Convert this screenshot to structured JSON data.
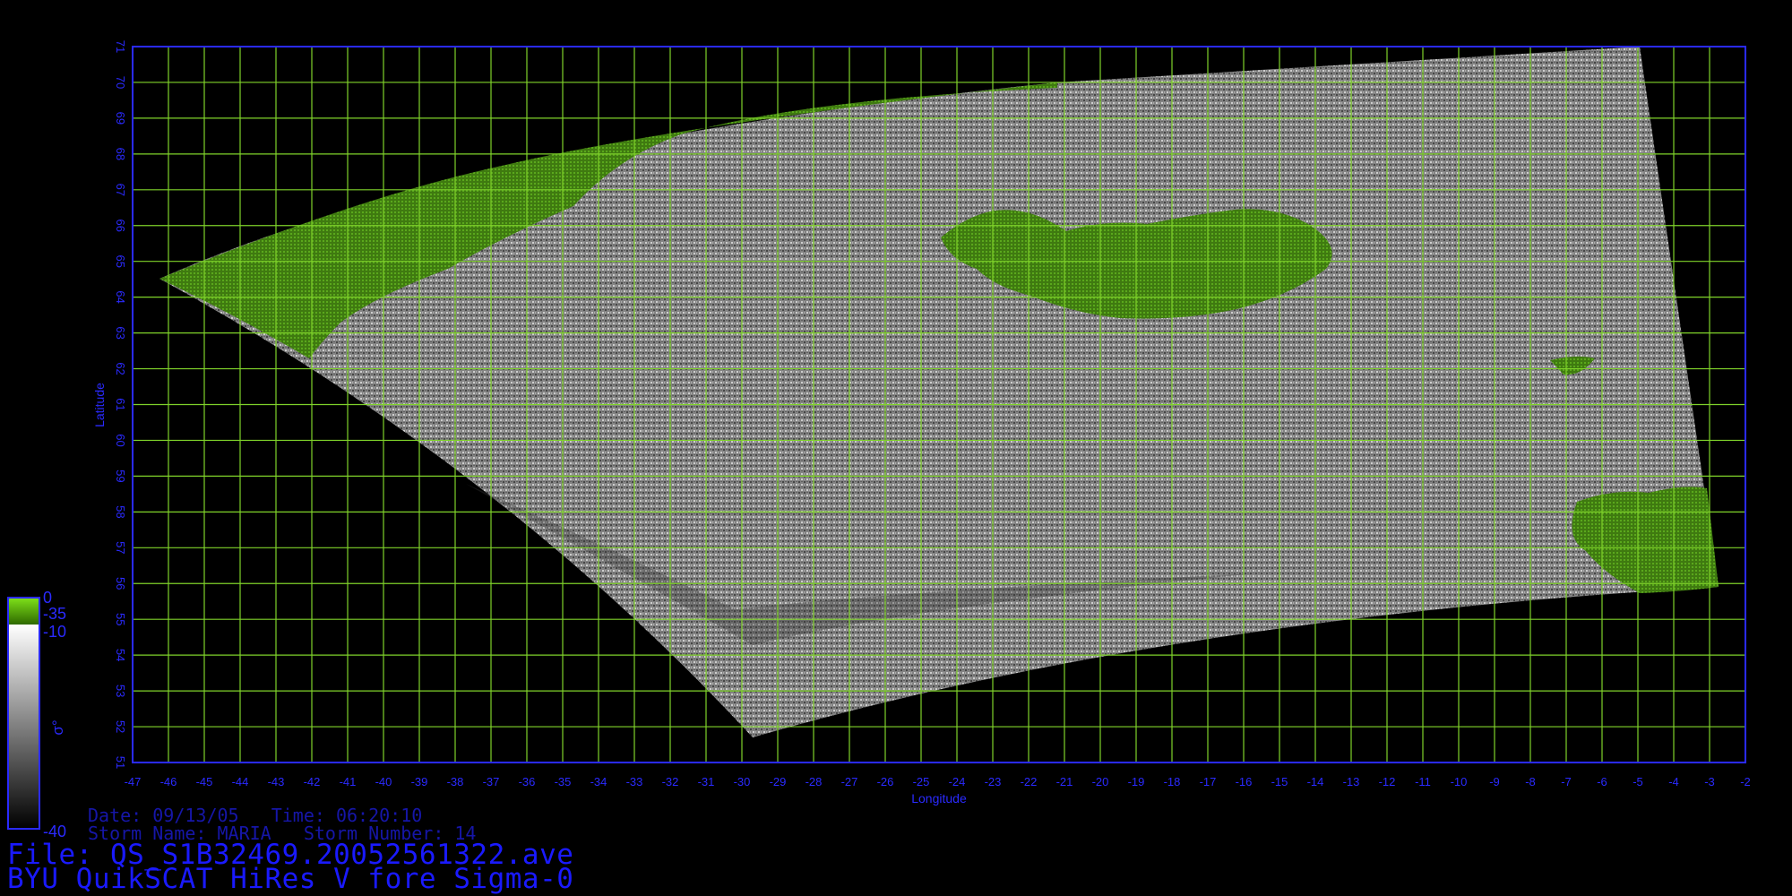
{
  "map": {
    "lon_range": [
      -47,
      -2
    ],
    "lat_range": [
      51,
      71
    ],
    "grid_step_lon": 1,
    "grid_step_lat": 1,
    "xlabel": "Longitude",
    "ylabel": "Latitude",
    "grid_color": "#7fd22a",
    "frame_color": "#2a2aff",
    "land_color": "#4a8a14"
  },
  "colorbar": {
    "labels": [
      "0",
      "-35",
      "-10",
      "-40"
    ],
    "symbol": "σ°",
    "green_color": "#4cb800",
    "top_color": "#ffffff",
    "bottom_color": "#000000"
  },
  "info": {
    "date_line": "Date: 09/13/05   Time: 06:20:10",
    "storm_line": "Storm Name: MARIA   Storm Number: 14",
    "file_line": "File: QS_S1B32469.20052561322.ave",
    "product_line": "BYU QuikSCAT HiRes V fore Sigma-0"
  }
}
